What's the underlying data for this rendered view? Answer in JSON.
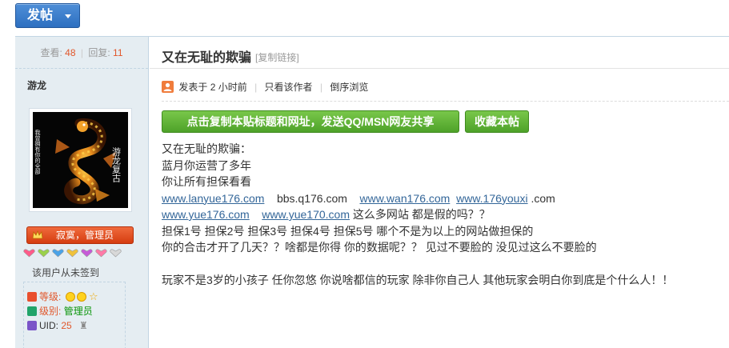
{
  "toolbar": {
    "post_label": "发帖"
  },
  "stats": {
    "views_label": "查看:",
    "views": "48",
    "replies_label": "回复:",
    "replies": "11"
  },
  "author": {
    "name": "游龙",
    "role": "寂寞，管理员",
    "sign_note": "该用户从未签到",
    "level_label": "等级:",
    "rank_label": "级别:",
    "rank_value": "管理员",
    "uid_label": "UID:",
    "uid": "25",
    "avatar_text_left": "我曾拥有你的全部",
    "avatar_text_right": "游龙复古"
  },
  "post": {
    "title": "又在无耻的欺骗",
    "copy_link": "[复制链接]",
    "posted_prefix": "发表于",
    "posted_time": "2 小时前",
    "only_author": "只看该作者",
    "reverse": "倒序浏览",
    "share_button": "点击复制本贴标题和网址，发送QQ/MSN网友共享",
    "fav_button": "收藏本帖",
    "lines": {
      "l1": "又在无耻的欺骗：",
      "l2": "蓝月你运营了多年",
      "l3": "你让所有担保看看",
      "link1": "www.lanyue176.com",
      "plain1": "bbs.q176.com",
      "link2": "www.wan176.com",
      "link3": "www.176youxi",
      "plain2": ".com",
      "link4": "www.yue176.com",
      "link5": "www.yue170.com",
      "plain3": "这么多网站  都是假的吗？？",
      "l6": "担保1号 担保2号 担保3号 担保4号 担保5号  哪个不是为以上的网站做担保的",
      "l7": "你的合击才开了几天？？啥都是你得 你的数据呢？？  见过不要脸的 没见过这么不要脸的",
      "l8": "玩家不是3岁的小孩子  任你忽悠 你说啥都信的玩家 除非你自己人 其他玩家会明白你到底是个什么人！！"
    }
  }
}
